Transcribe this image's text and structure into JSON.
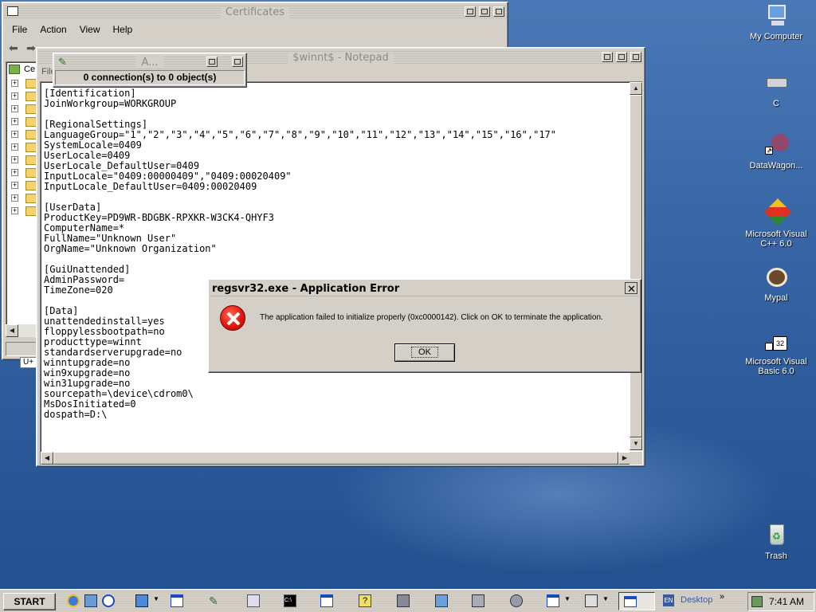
{
  "certificates": {
    "title": "Certificates",
    "menu": [
      "File",
      "Action",
      "View",
      "Help"
    ],
    "tree_root_label": "Ce",
    "status_label": "U+"
  },
  "notepad": {
    "title": "$winnt$ - Notepad",
    "menu_fragment": "File",
    "content": "[Identification]\nJoinWorkgroup=WORKGROUP\n\n[RegionalSettings]\nLanguageGroup=\"1\",\"2\",\"3\",\"4\",\"5\",\"6\",\"7\",\"8\",\"9\",\"10\",\"11\",\"12\",\"13\",\"14\",\"15\",\"16\",\"17\"\nSystemLocale=0409\nUserLocale=0409\nUserLocale_DefaultUser=0409\nInputLocale=\"0409:00000409\",\"0409:00020409\"\nInputLocale_DefaultUser=0409:00020409\n\n[UserData]\nProductKey=PD9WR-BDGBK-RPXKR-W3CK4-QHYF3\nComputerName=*\nFullName=\"Unknown User\"\nOrgName=\"Unknown Organization\"\n\n[GuiUnattended]\nAdminPassword=\nTimeZone=020\n\n[Data]\nunattendedinstall=yes\nfloppylessbootpath=no\nproducttype=winnt\nstandardserverupgrade=no\nwinntupgrade=no\nwin9xupgrade=no\nwin31upgrade=no\nsourcepath=\\device\\cdrom0\\\nMsDosInitiated=0\ndospath=D:\\"
  },
  "small_window": {
    "title": "A...",
    "status": "0 connection(s) to 0 object(s)"
  },
  "error_dialog": {
    "title": "regsvr32.exe - Application Error",
    "message": "The application failed to initialize properly (0xc0000142). Click on OK to terminate the application.",
    "ok_label": "OK",
    "close_glyph": "✕"
  },
  "desktop_icons": [
    {
      "label": "My Computer",
      "icon": "computer-icon"
    },
    {
      "label": "C",
      "icon": "drive-icon"
    },
    {
      "label": "DataWagon...",
      "icon": "shortcut-icon"
    },
    {
      "label": "Microsoft Visual C++ 6.0",
      "icon": "visual-cpp-icon"
    },
    {
      "label": "Mypal",
      "icon": "mypal-icon"
    },
    {
      "label": "Microsoft Visual Basic 6.0",
      "icon": "visual-basic-icon"
    },
    {
      "label": "Trash",
      "icon": "trash-icon"
    }
  ],
  "taskbar": {
    "start_label": "START",
    "desktop_label": "Desktop",
    "lang_label": "EN",
    "chevron": "»",
    "clock": "7:41 AM"
  }
}
